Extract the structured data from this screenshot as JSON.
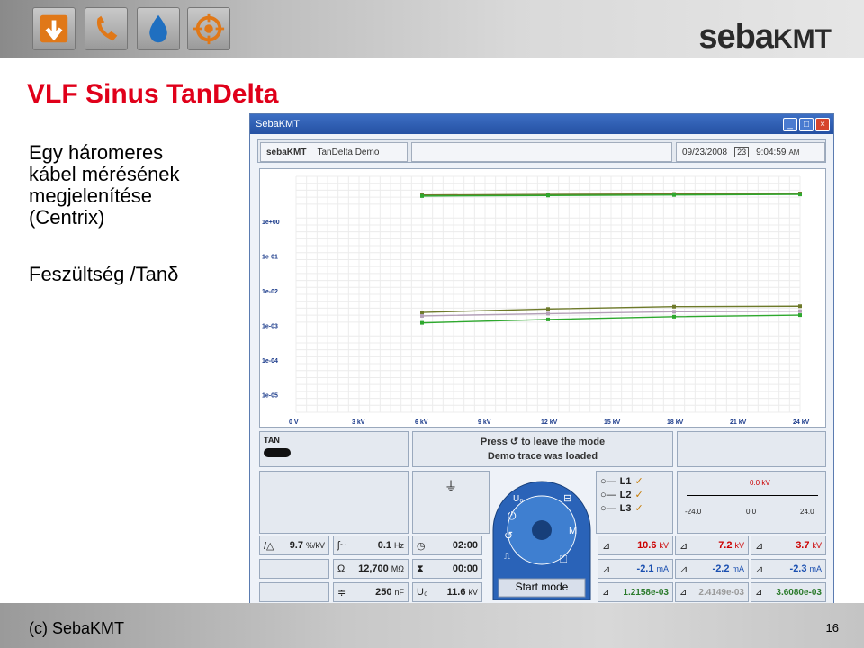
{
  "brand": {
    "main": "seba",
    "suffix": "KMT"
  },
  "title": "VLF Sinus TanDelta",
  "description": "Egy háromeres\nkábel mérésének\nmegjelenítése\n(Centrix)",
  "subtitle": "Feszültség /Tanδ",
  "window": {
    "title": "SebaKMT",
    "header_logo": "sebaKMT",
    "mode": "TanDelta Demo",
    "date": "09/23/2008",
    "time": "9:04:59",
    "time_suffix": "AM",
    "cal_icon_label": "23"
  },
  "chart_data": {
    "type": "line",
    "y_scale": "log",
    "y_ticks": [
      "1e+00",
      "1e-01",
      "1e-02",
      "1e-03",
      "1e-04",
      "1e-05"
    ],
    "x_ticks": [
      "0 V",
      "3 kV",
      "6 kV",
      "9 kV",
      "12 kV",
      "15 kV",
      "18 kV",
      "21 kV",
      "24 kV"
    ],
    "x": [
      6,
      12,
      18,
      24
    ],
    "series": [
      {
        "values": [
          0.0024,
          0.003,
          0.0035,
          0.0036
        ],
        "color": "#6e7a2a"
      },
      {
        "values": [
          0.0019,
          0.0022,
          0.0025,
          0.0026
        ],
        "color": "#b4a0b8"
      },
      {
        "values": [
          0.0012,
          0.0015,
          0.0018,
          0.002
        ],
        "color": "#2ea82e"
      },
      {
        "values": [
          5.8,
          6.0,
          6.2,
          6.4
        ],
        "color": "#6e7a2a"
      },
      {
        "values": [
          5.4,
          5.6,
          5.8,
          6.0
        ],
        "color": "#2ea82e"
      }
    ]
  },
  "controls": {
    "tan_label": "TAN",
    "message1a": "Press",
    "message1b": "to leave the mode",
    "message2": "Demo trace was loaded",
    "phases": [
      "L1",
      "L2",
      "L3"
    ],
    "checks": [
      "✓",
      "✓",
      "✓"
    ],
    "scale": {
      "value": "0.0 kV",
      "min": "-24.0",
      "mid": "0.0",
      "max": "24.0"
    },
    "start_mode": "Start mode",
    "readouts": [
      {
        "name": "tan-per-kv",
        "value": "9.7",
        "unit": "%/kV"
      },
      {
        "name": "frequency",
        "value": "0.1",
        "unit": "Hz"
      },
      {
        "name": "timer1",
        "value": "02:00"
      },
      {
        "name": "resistance",
        "value": "12,700",
        "unit": "MΩ"
      },
      {
        "name": "timer2",
        "value": "00:00"
      },
      {
        "name": "capacitance",
        "value": "250",
        "unit": "nF"
      },
      {
        "name": "u0",
        "value": "11.6",
        "unit": "kV"
      }
    ],
    "phase_values": {
      "kv": [
        "10.6",
        "7.2",
        "3.7"
      ],
      "ma": [
        "-2.1",
        "-2.2",
        "-2.3"
      ],
      "tan": [
        "1.2158e-03",
        "2.4149e-03",
        "3.6080e-03"
      ],
      "unit_kv": "kV",
      "unit_ma": "mA"
    }
  },
  "footer": {
    "left": "(c) SebaKMT",
    "page": "16"
  }
}
